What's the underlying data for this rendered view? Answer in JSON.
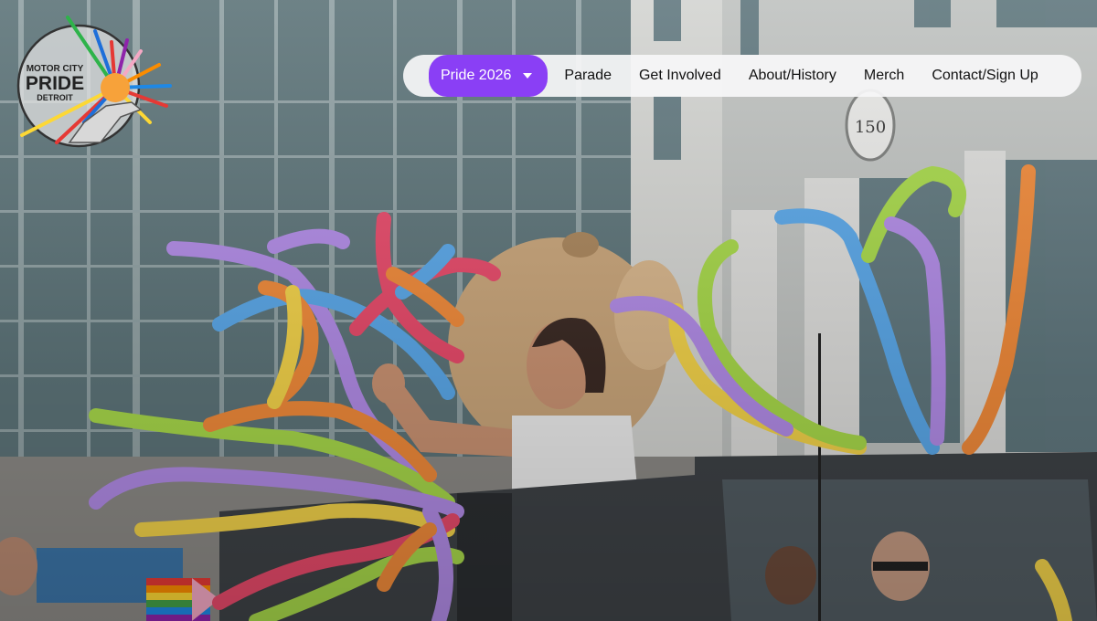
{
  "logo": {
    "line1": "MOTOR CITY",
    "line2": "PRIDE",
    "line3": "DETROIT"
  },
  "nav": {
    "items": [
      {
        "label": "Pride 2026",
        "active": true,
        "has_dropdown": true
      },
      {
        "label": "Parade"
      },
      {
        "label": "Get Involved"
      },
      {
        "label": "About/History"
      },
      {
        "label": "Merch"
      },
      {
        "label": "Contact/Sign Up"
      }
    ]
  },
  "hero": {
    "building_number": "150"
  },
  "colors": {
    "accent": "#8a3ff5",
    "nav_background": "#f6f6f8",
    "nav_text": "#111111"
  }
}
